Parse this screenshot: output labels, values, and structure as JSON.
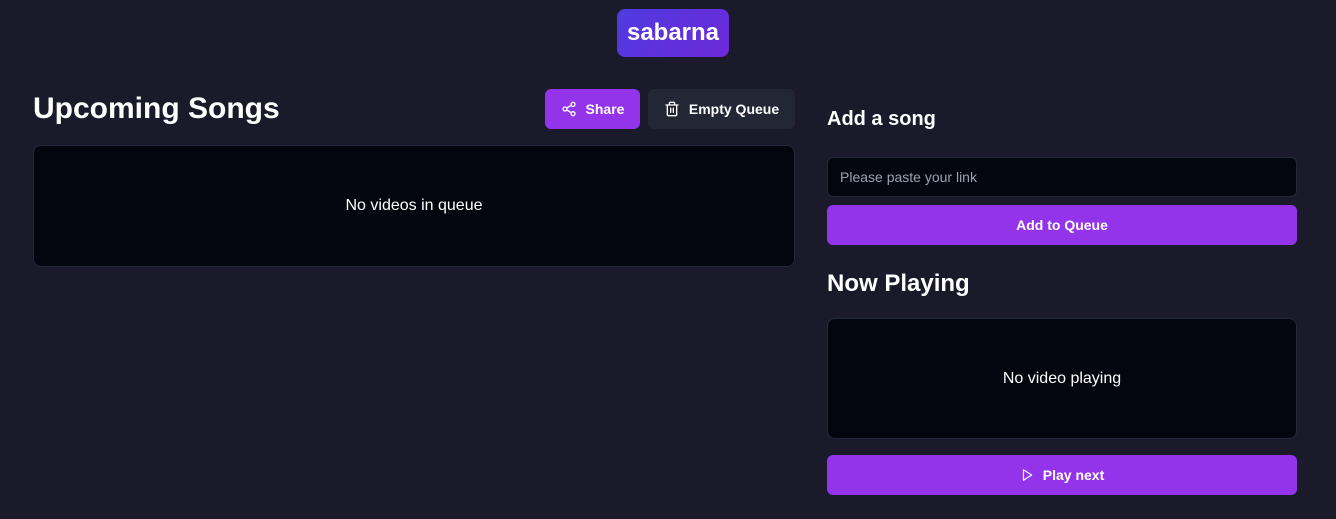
{
  "header": {
    "logo_text": "sabarna"
  },
  "queue": {
    "title": "Upcoming Songs",
    "share_label": "Share",
    "empty_queue_label": "Empty Queue",
    "empty_message": "No videos in queue"
  },
  "add_song": {
    "title": "Add a song",
    "input_placeholder": "Please paste your link",
    "input_value": "",
    "add_button_label": "Add to Queue"
  },
  "now_playing": {
    "title": "Now Playing",
    "empty_message": "No video playing",
    "play_next_label": "Play next"
  },
  "icons": {
    "share": "share-icon",
    "trash": "trash-icon",
    "play": "play-icon"
  },
  "colors": {
    "background": "#1a1a2b",
    "accent": "#9333ea",
    "panel": "#03060f",
    "secondary_button": "#232735"
  }
}
